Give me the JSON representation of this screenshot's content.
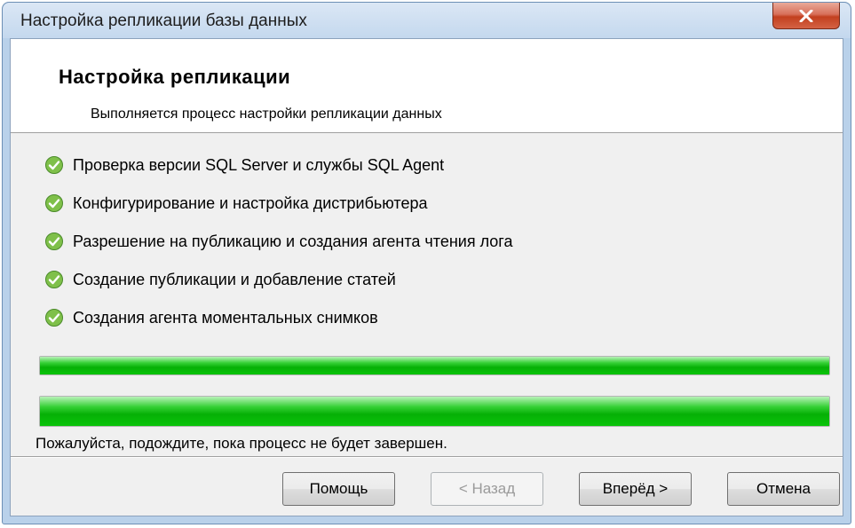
{
  "window": {
    "title": "Настройка репликации базы данных",
    "close_icon": "close-x-icon"
  },
  "header": {
    "title": "Настройка репликации",
    "subtitle": "Выполняется процесс настройки репликации данных"
  },
  "steps": [
    {
      "label": "Проверка версии SQL Server и службы SQL Agent",
      "status": "done",
      "icon": "green-check-icon"
    },
    {
      "label": "Конфигурирование и настройка дистрибьютера",
      "status": "done",
      "icon": "green-check-icon"
    },
    {
      "label": "Разрешение на публикацию и создания агента чтения лога",
      "status": "done",
      "icon": "green-check-icon"
    },
    {
      "label": "Создание публикации и добавление статей",
      "status": "done",
      "icon": "green-check-icon"
    },
    {
      "label": "Создания агента моментальных снимков",
      "status": "done",
      "icon": "green-check-icon"
    }
  ],
  "progress": {
    "step_progress_percent": 100,
    "overall_progress_percent": 100,
    "color": "#06b006"
  },
  "status_text": "Пожалуйста, подождите, пока процесс не будет завершен.",
  "buttons": {
    "help": "Помощь",
    "back": "< Назад",
    "next": "Вперёд >",
    "cancel": "Отмена"
  }
}
